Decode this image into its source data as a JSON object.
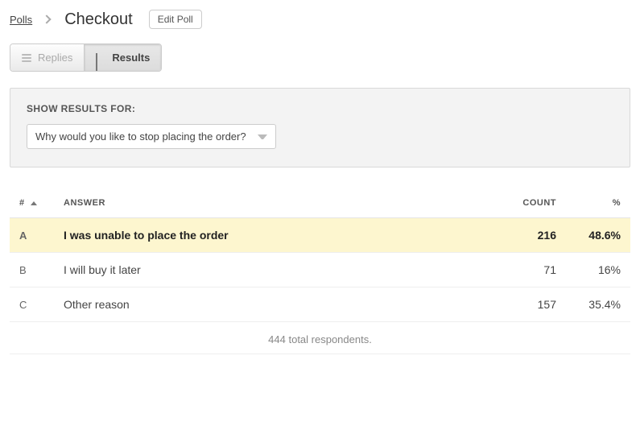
{
  "breadcrumb": {
    "parent": "Polls",
    "title": "Checkout",
    "edit_label": "Edit Poll"
  },
  "tabs": {
    "replies": "Replies",
    "results": "Results"
  },
  "filter": {
    "label": "SHOW RESULTS FOR:",
    "selected": "Why would you like to stop placing the order?"
  },
  "table": {
    "headers": {
      "idx": "#",
      "answer": "ANSWER",
      "count": "COUNT",
      "pct": "%"
    },
    "rows": [
      {
        "idx": "A",
        "answer": "I was unable to place the order",
        "count": "216",
        "pct": "48.6%"
      },
      {
        "idx": "B",
        "answer": "I will buy it later",
        "count": "71",
        "pct": "16%"
      },
      {
        "idx": "C",
        "answer": "Other reason",
        "count": "157",
        "pct": "35.4%"
      }
    ],
    "footer": "444 total respondents."
  }
}
